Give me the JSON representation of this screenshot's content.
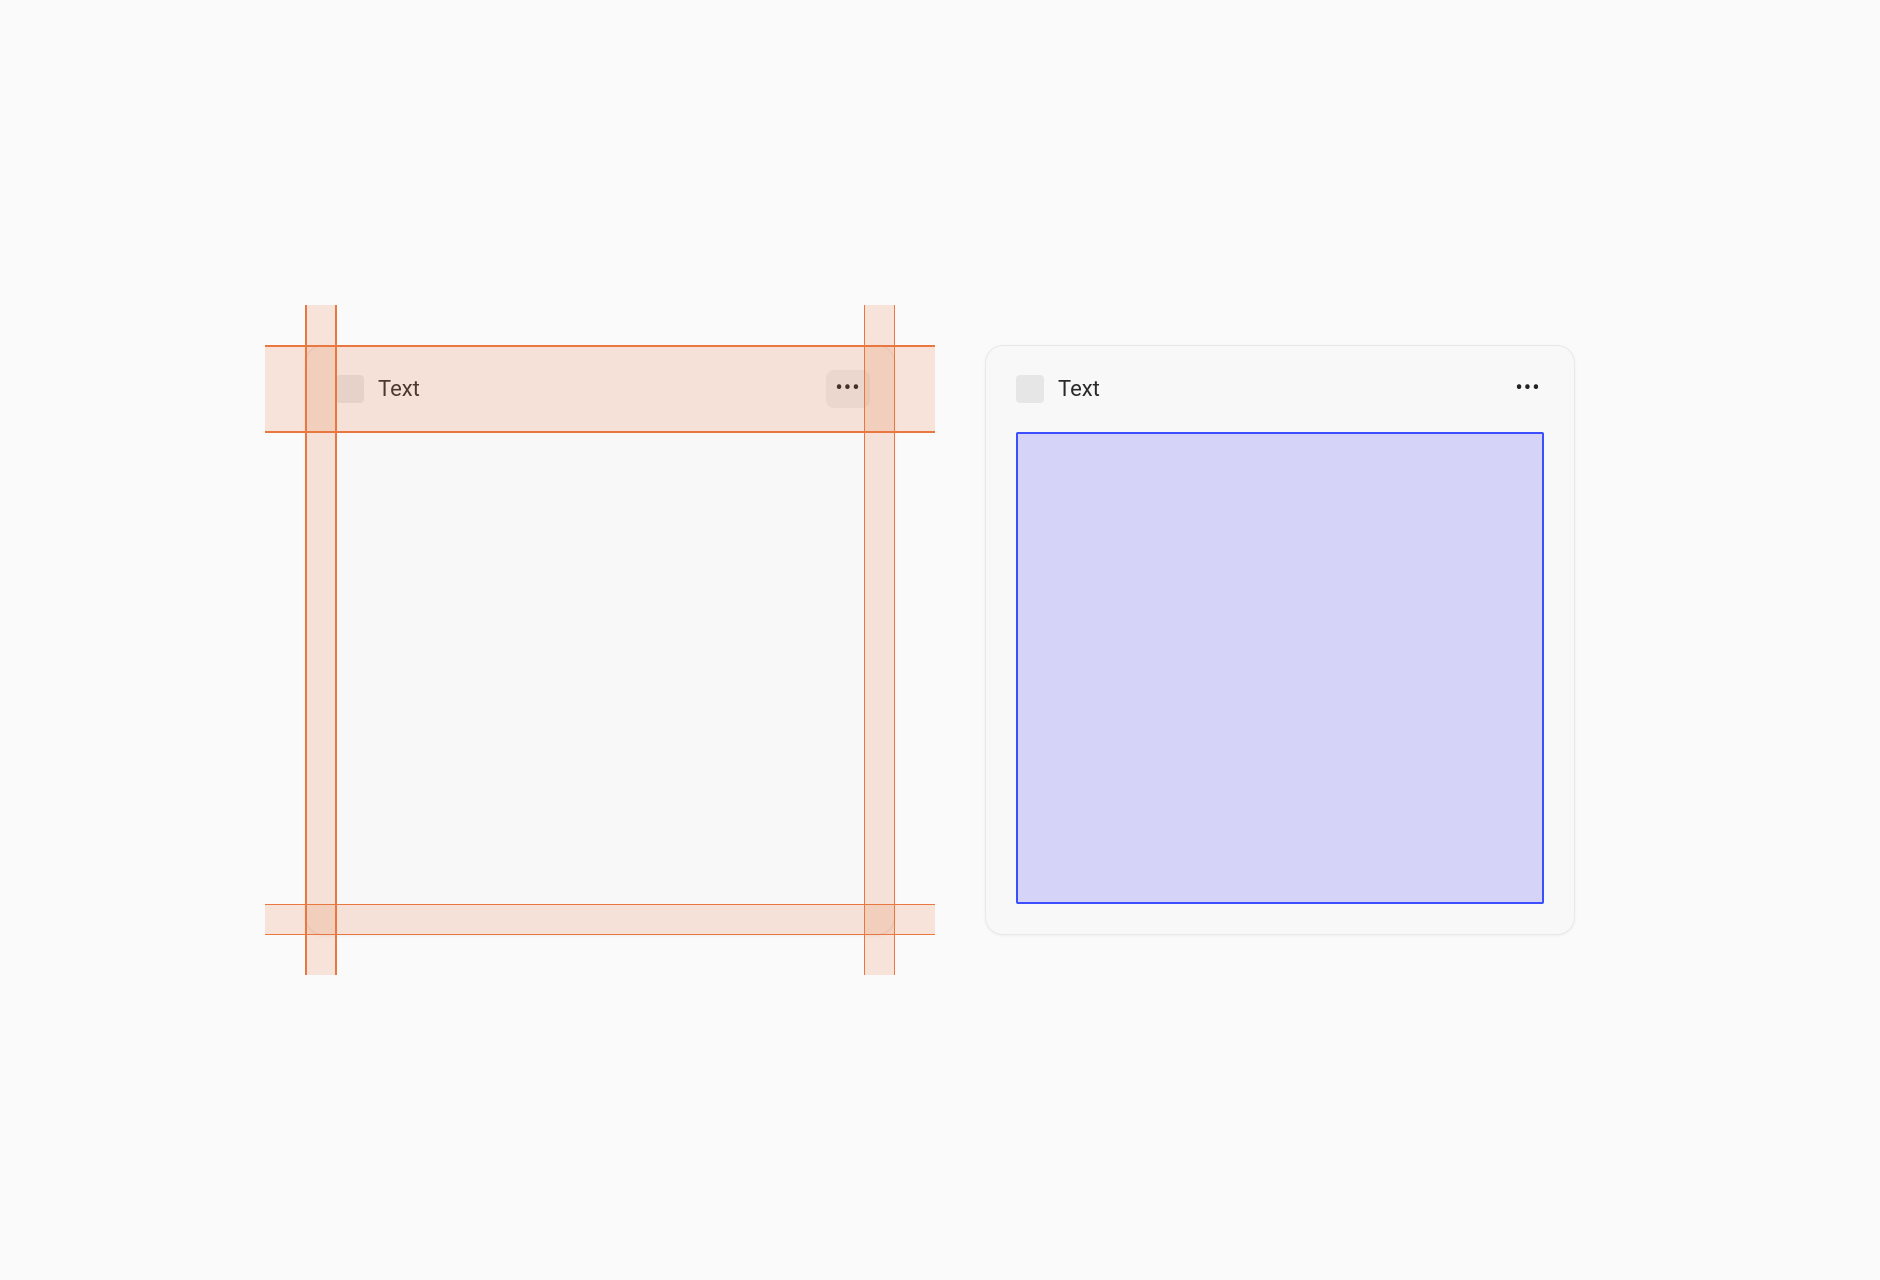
{
  "cards": [
    {
      "title": "Text",
      "showPaddingGuides": true,
      "moreHovered": true,
      "contentHighlighted": false
    },
    {
      "title": "Text",
      "showPaddingGuides": false,
      "moreHovered": false,
      "contentHighlighted": true
    }
  ],
  "colors": {
    "guideOrange": "#e87840",
    "selectionBlue": "#3b4fff",
    "selectionFill": "#d6d3f8"
  }
}
